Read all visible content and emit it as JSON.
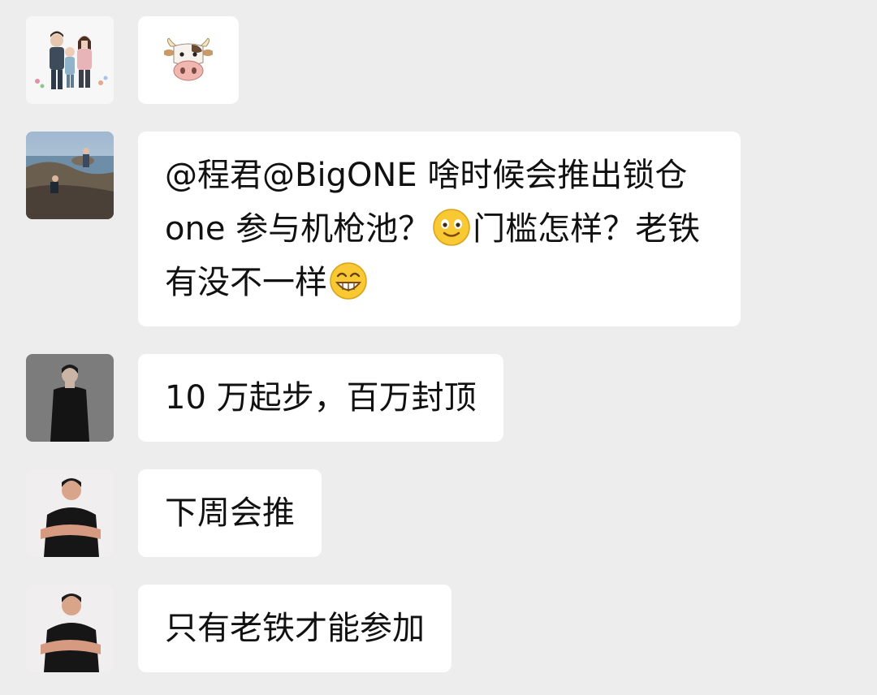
{
  "chat": {
    "messages": [
      {
        "sender_avatar": "family-cartoon-avatar",
        "content_type": "emoji",
        "emoji_name": "cow-face-emoji"
      },
      {
        "sender_avatar": "seaside-photo-avatar",
        "content_type": "text",
        "parts": {
          "text1": "@程君@BigONE  啥时候会推出锁仓 one 参与机枪池？",
          "emoji1": "smiling-face-emoji",
          "text2": "门槛怎样？老铁有没不一样",
          "emoji2": "grinning-face-emoji"
        }
      },
      {
        "sender_avatar": "man-black-tee-avatar",
        "content_type": "text",
        "text": "10 万起步，百万封顶"
      },
      {
        "sender_avatar": "arms-crossed-man-avatar",
        "content_type": "text",
        "text": "下周会推"
      },
      {
        "sender_avatar": "arms-crossed-man-avatar",
        "content_type": "text",
        "text": "只有老铁才能参加"
      }
    ]
  }
}
